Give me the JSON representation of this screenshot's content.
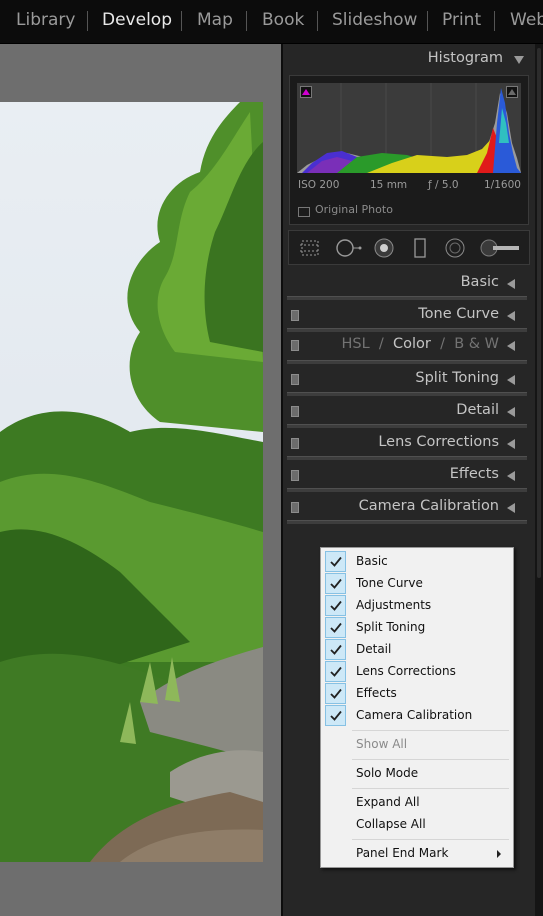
{
  "modules": [
    "Library",
    "Develop",
    "Map",
    "Book",
    "Slideshow",
    "Print",
    "Web"
  ],
  "active_module": "Develop",
  "histogram": {
    "title": "Histogram",
    "iso": "ISO 200",
    "focal": "15 mm",
    "aperture": "ƒ / 5.0",
    "shutter": "1/1600",
    "original_photo": "Original Photo"
  },
  "tools": [
    "crop-overlay-icon",
    "spot-removal-icon",
    "red-eye-icon",
    "graduated-filter-icon",
    "radial-filter-icon",
    "adjustment-brush-icon"
  ],
  "panels": {
    "basic": "Basic",
    "tone_curve": "Tone Curve",
    "hsl": "HSL",
    "slash1": "/",
    "color": "Color",
    "slash2": "/",
    "bw": "B & W",
    "split_toning": "Split Toning",
    "detail": "Detail",
    "lens_corrections": "Lens Corrections",
    "effects": "Effects",
    "camera_calibration": "Camera Calibration"
  },
  "context_menu": {
    "checked_items": [
      "Basic",
      "Tone Curve",
      "Adjustments",
      "Split Toning",
      "Detail",
      "Lens Corrections",
      "Effects",
      "Camera Calibration"
    ],
    "show_all": "Show All",
    "solo_mode": "Solo Mode",
    "expand_all": "Expand All",
    "collapse_all": "Collapse All",
    "panel_end_mark": "Panel End Mark"
  },
  "colors": {
    "module_bar": "#0c0c0c",
    "panel_bg": "#262626",
    "photo_surround": "#6e6e6e",
    "menu_bg": "#f1f1f1",
    "menu_check_bg": "#cde8f7"
  }
}
